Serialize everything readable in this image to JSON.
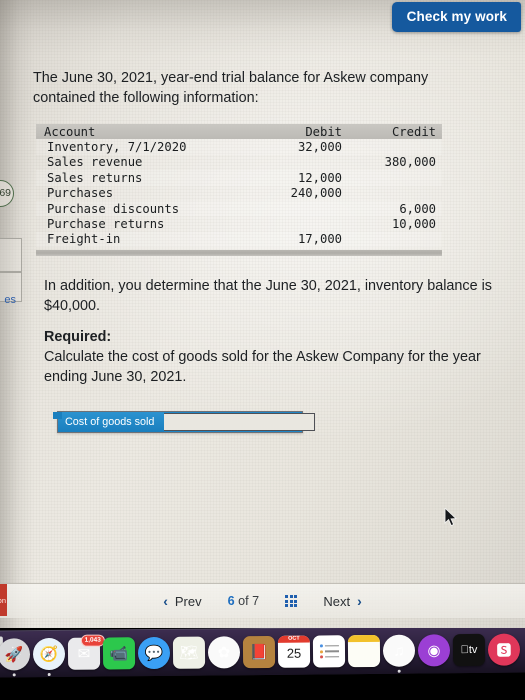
{
  "toolbar": {
    "check_my_work_label": "Check my work",
    "accent_color": "#15599e"
  },
  "question": {
    "intro": "The June 30, 2021, year-end trial balance for Askew company contained the following information:",
    "addition": "In addition, you determine that the June 30, 2021, inventory balance is $40,000.",
    "required_title": "Required:",
    "required_text": "Calculate the cost of goods sold for the Askew Company for the year ending June 30, 2021."
  },
  "trial_balance": {
    "headers": [
      "Account",
      "Debit",
      "Credit"
    ],
    "rows": [
      {
        "account": "Inventory, 7/1/2020",
        "debit": "32,000",
        "credit": ""
      },
      {
        "account": "Sales revenue",
        "debit": "",
        "credit": "380,000"
      },
      {
        "account": "Sales returns",
        "debit": "12,000",
        "credit": ""
      },
      {
        "account": "Purchases",
        "debit": "240,000",
        "credit": ""
      },
      {
        "account": "Purchase discounts",
        "debit": "",
        "credit": "6,000"
      },
      {
        "account": "Purchase returns",
        "debit": "",
        "credit": "10,000"
      },
      {
        "account": "Freight-in",
        "debit": "17,000",
        "credit": ""
      }
    ]
  },
  "answer": {
    "label": "Cost of goods sold",
    "value": "",
    "placeholder": "",
    "label_color": "#1a7fbe"
  },
  "nav": {
    "prev_label": "Prev",
    "next_label": "Next",
    "prev_chevron": "‹",
    "next_chevron": "›",
    "current_page": "6",
    "of_label": "of",
    "total_pages": "7",
    "grid_icon": "grid-icon"
  },
  "edge_chrome": {
    "badge": "69",
    "link_fragment": "es",
    "red_fragment": "tion"
  },
  "dock": {
    "items": [
      {
        "name": "launchpad",
        "glyph": "🚀",
        "bg": "#d8d8da",
        "shape": "circle",
        "badge": "",
        "running": true
      },
      {
        "name": "safari",
        "glyph": "🧭",
        "bg": "#e8f3fb",
        "shape": "circle",
        "badge": "",
        "running": true
      },
      {
        "name": "mail",
        "glyph": "✉",
        "bg": "#eaeaec",
        "shape": "square",
        "badge": "1,043",
        "running": false
      },
      {
        "name": "facetime",
        "glyph": "📹",
        "bg": "#2cc84c",
        "shape": "square",
        "badge": "",
        "running": false
      },
      {
        "name": "messages",
        "glyph": "💬",
        "bg": "#3aa0f5",
        "shape": "circle",
        "badge": "",
        "running": false
      },
      {
        "name": "maps",
        "glyph": "🗺",
        "bg": "#eef0e6",
        "shape": "square",
        "badge": "",
        "running": false
      },
      {
        "name": "photos",
        "glyph": "✿",
        "bg": "#fafafa",
        "shape": "circle",
        "badge": "",
        "running": false
      },
      {
        "name": "contacts",
        "glyph": "📕",
        "bg": "#b5833f",
        "shape": "square",
        "badge": "",
        "running": false
      },
      {
        "name": "calendar",
        "glyph": "25",
        "bg": "#ffffff",
        "shape": "square",
        "badge": "",
        "running": false
      },
      {
        "name": "reminders",
        "glyph": "☰",
        "bg": "#ffffff",
        "shape": "square",
        "badge": "",
        "running": false
      },
      {
        "name": "notes",
        "glyph": "▭",
        "bg": "#fdfdf6",
        "shape": "square",
        "badge": "",
        "running": false
      },
      {
        "name": "music",
        "glyph": "♫",
        "bg": "#fafafa",
        "shape": "circle",
        "badge": "",
        "running": true
      },
      {
        "name": "podcasts",
        "glyph": "◉",
        "bg": "#9b3fd4",
        "shape": "circle",
        "badge": "",
        "running": false
      },
      {
        "name": "apple-tv",
        "glyph": "tv",
        "bg": "#111111",
        "shape": "square",
        "badge": "",
        "running": false
      },
      {
        "name": "app-store",
        "glyph": "🆂",
        "bg": "#e0375a",
        "shape": "circle",
        "badge": "",
        "running": false
      }
    ],
    "calendar_month": "OCT",
    "calendar_day": "25"
  }
}
